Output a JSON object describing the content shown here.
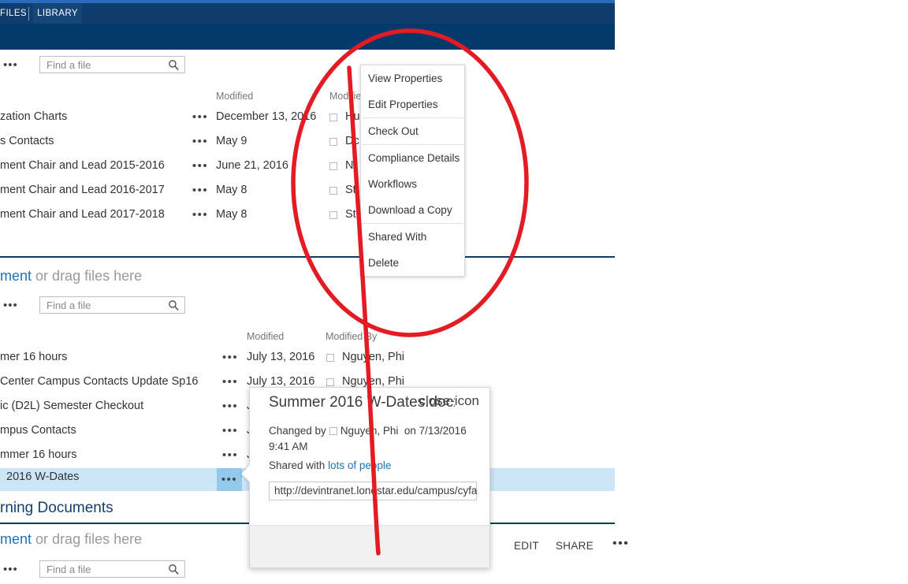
{
  "ribbon": {
    "tabs": [
      {
        "label": "FILES",
        "selected": false
      },
      {
        "label": "LIBRARY",
        "selected": true
      }
    ]
  },
  "search": {
    "placeholder": "Find a file",
    "icon": "search-icon"
  },
  "overflow_icon": "ellipsis-icon",
  "sections": [
    {
      "id": "section-1",
      "columns": {
        "name": "",
        "modified": "Modified",
        "modified_by": "Modified By"
      },
      "rows": [
        {
          "name": "zation Charts",
          "modified": "December 13, 2016",
          "modified_by": "Hu"
        },
        {
          "name": "s Contacts",
          "modified": "May 9",
          "modified_by": "Dc"
        },
        {
          "name": "ment Chair and Lead 2015-2016",
          "modified": "June 21, 2016",
          "modified_by": "N"
        },
        {
          "name": "ment Chair and Lead 2016-2017",
          "modified": "May 8",
          "modified_by": "St"
        },
        {
          "name": "ment Chair and Lead 2017-2018",
          "modified": "May 8",
          "modified_by": "Sto"
        }
      ]
    },
    {
      "id": "section-2",
      "new_document": {
        "link": "ment",
        "rest": "or drag files here"
      },
      "columns": {
        "name": "",
        "modified": "Modified",
        "modified_by": "Modified By"
      },
      "rows": [
        {
          "name": "mer 16 hours",
          "modified": "July 13, 2016",
          "modified_by": "Nguyen, Phi",
          "selected": false
        },
        {
          "name": "Center Campus Contacts Update Sp16",
          "modified": "July 13, 2016",
          "modified_by": "Nguyen, Phi",
          "selected": false
        },
        {
          "name": "ic (D2L) Semester Checkout",
          "modified": "J",
          "modified_by": "",
          "selected": false
        },
        {
          "name": "mpus Contacts",
          "modified": "J",
          "modified_by": "",
          "selected": false
        },
        {
          "name": "mmer 16 hours",
          "modified": "J",
          "modified_by": "",
          "selected": false
        },
        {
          "name": "2016 W-Dates",
          "modified": "",
          "modified_by": "",
          "selected": true
        }
      ]
    },
    {
      "id": "section-3",
      "title": "rning Documents",
      "new_document": {
        "link": "ment",
        "rest": "or drag files here"
      }
    }
  ],
  "context_menu": {
    "items": [
      {
        "label": "View Properties",
        "divider_after": false
      },
      {
        "label": "Edit Properties",
        "divider_after": true
      },
      {
        "label": "Check Out",
        "divider_after": true
      },
      {
        "label": "Compliance Details",
        "divider_after": false
      },
      {
        "label": "Workflows",
        "divider_after": false
      },
      {
        "label": "Download a Copy",
        "divider_after": true
      },
      {
        "label": "Shared With",
        "divider_after": false
      },
      {
        "label": "Delete",
        "divider_after": false
      }
    ]
  },
  "card": {
    "title": "Summer 2016 W-Dates.docx",
    "close_icon": "close-icon",
    "changed_by_label": "Changed by",
    "changed_by_user": "Nguyen, Phi",
    "changed_on": "on 7/13/2016 9:41 AM",
    "shared_with_label": "Shared with",
    "shared_with_link": "lots of people",
    "url": "http://devintranet.lonestar.edu/campus/cyfa",
    "actions": {
      "edit": "EDIT",
      "share": "SHARE",
      "more": "•••"
    }
  },
  "annotation": {
    "color": "#e31b23",
    "shapes": [
      "ellipse-highlight",
      "vertical-line"
    ]
  }
}
